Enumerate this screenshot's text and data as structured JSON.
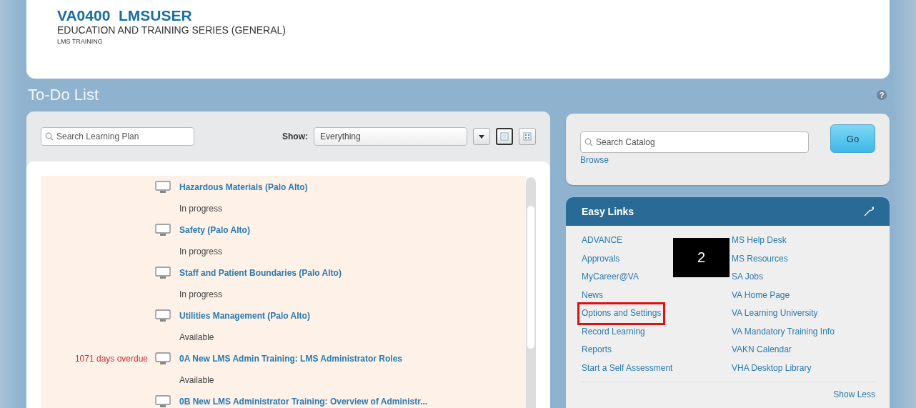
{
  "header": {
    "title": "VA0400  LMSUSER",
    "subtitle": "EDUCATION AND TRAINING SERIES (GENERAL)",
    "caption": "LMS TRAINING"
  },
  "section_title": "To-Do List",
  "help": "?",
  "todo": {
    "search": {
      "placeholder": "Search Learning Plan"
    },
    "show_label": "Show:",
    "show_value": "Everything",
    "views": [
      {
        "kind": "list",
        "selected": true
      },
      {
        "kind": "grid",
        "selected": false
      }
    ],
    "items": [
      {
        "title": "Hazardous Materials (Palo Alto)",
        "status": "In progress"
      },
      {
        "title": "Safety (Palo Alto)",
        "status": "In progress"
      },
      {
        "title": "Staff and Patient Boundaries (Palo Alto)",
        "status": "In progress"
      },
      {
        "title": "Utilities Management (Palo Alto)",
        "status": "Available"
      },
      {
        "title": "0A New LMS Admin Training: LMS Administrator Roles",
        "status": "Available",
        "overdue": "1071 days overdue"
      },
      {
        "title": "0B New LMS Administrator Training: Overview of Administr..."
      }
    ]
  },
  "catalog": {
    "search": {
      "placeholder": "Search Catalog"
    },
    "go": "Go",
    "browse": "Browse"
  },
  "easy_links": {
    "title": "Easy Links",
    "left": [
      {
        "label": "ADVANCE",
        "highlighted": false
      },
      {
        "label": "Approvals",
        "highlighted": false
      },
      {
        "label": "MyCareer@VA",
        "highlighted": false
      },
      {
        "label": "News",
        "highlighted": false
      },
      {
        "label": "Options and Settings",
        "highlighted": true
      },
      {
        "label": "Record Learning",
        "highlighted": false
      },
      {
        "label": "Reports",
        "highlighted": false
      },
      {
        "label": "Start a Self Assessment",
        "highlighted": false
      }
    ],
    "right": [
      "MS Help Desk",
      "MS Resources",
      "SA Jobs",
      "VA Home Page",
      "VA Learning University",
      "VA Mandatory Training Info",
      "VAKN Calendar",
      "VHA Desktop Library"
    ],
    "show_less": "Show Less"
  },
  "annotation": {
    "label": "2"
  }
}
